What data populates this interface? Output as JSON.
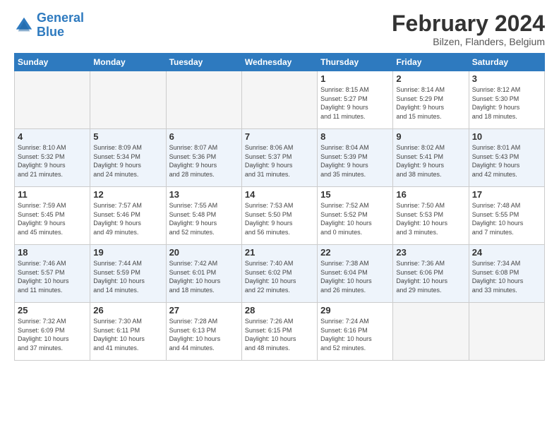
{
  "header": {
    "logo_line1": "General",
    "logo_line2": "Blue",
    "month_year": "February 2024",
    "location": "Bilzen, Flanders, Belgium"
  },
  "days_of_week": [
    "Sunday",
    "Monday",
    "Tuesday",
    "Wednesday",
    "Thursday",
    "Friday",
    "Saturday"
  ],
  "weeks": [
    [
      {
        "day": "",
        "info": ""
      },
      {
        "day": "",
        "info": ""
      },
      {
        "day": "",
        "info": ""
      },
      {
        "day": "",
        "info": ""
      },
      {
        "day": "1",
        "info": "Sunrise: 8:15 AM\nSunset: 5:27 PM\nDaylight: 9 hours\nand 11 minutes."
      },
      {
        "day": "2",
        "info": "Sunrise: 8:14 AM\nSunset: 5:29 PM\nDaylight: 9 hours\nand 15 minutes."
      },
      {
        "day": "3",
        "info": "Sunrise: 8:12 AM\nSunset: 5:30 PM\nDaylight: 9 hours\nand 18 minutes."
      }
    ],
    [
      {
        "day": "4",
        "info": "Sunrise: 8:10 AM\nSunset: 5:32 PM\nDaylight: 9 hours\nand 21 minutes."
      },
      {
        "day": "5",
        "info": "Sunrise: 8:09 AM\nSunset: 5:34 PM\nDaylight: 9 hours\nand 24 minutes."
      },
      {
        "day": "6",
        "info": "Sunrise: 8:07 AM\nSunset: 5:36 PM\nDaylight: 9 hours\nand 28 minutes."
      },
      {
        "day": "7",
        "info": "Sunrise: 8:06 AM\nSunset: 5:37 PM\nDaylight: 9 hours\nand 31 minutes."
      },
      {
        "day": "8",
        "info": "Sunrise: 8:04 AM\nSunset: 5:39 PM\nDaylight: 9 hours\nand 35 minutes."
      },
      {
        "day": "9",
        "info": "Sunrise: 8:02 AM\nSunset: 5:41 PM\nDaylight: 9 hours\nand 38 minutes."
      },
      {
        "day": "10",
        "info": "Sunrise: 8:01 AM\nSunset: 5:43 PM\nDaylight: 9 hours\nand 42 minutes."
      }
    ],
    [
      {
        "day": "11",
        "info": "Sunrise: 7:59 AM\nSunset: 5:45 PM\nDaylight: 9 hours\nand 45 minutes."
      },
      {
        "day": "12",
        "info": "Sunrise: 7:57 AM\nSunset: 5:46 PM\nDaylight: 9 hours\nand 49 minutes."
      },
      {
        "day": "13",
        "info": "Sunrise: 7:55 AM\nSunset: 5:48 PM\nDaylight: 9 hours\nand 52 minutes."
      },
      {
        "day": "14",
        "info": "Sunrise: 7:53 AM\nSunset: 5:50 PM\nDaylight: 9 hours\nand 56 minutes."
      },
      {
        "day": "15",
        "info": "Sunrise: 7:52 AM\nSunset: 5:52 PM\nDaylight: 10 hours\nand 0 minutes."
      },
      {
        "day": "16",
        "info": "Sunrise: 7:50 AM\nSunset: 5:53 PM\nDaylight: 10 hours\nand 3 minutes."
      },
      {
        "day": "17",
        "info": "Sunrise: 7:48 AM\nSunset: 5:55 PM\nDaylight: 10 hours\nand 7 minutes."
      }
    ],
    [
      {
        "day": "18",
        "info": "Sunrise: 7:46 AM\nSunset: 5:57 PM\nDaylight: 10 hours\nand 11 minutes."
      },
      {
        "day": "19",
        "info": "Sunrise: 7:44 AM\nSunset: 5:59 PM\nDaylight: 10 hours\nand 14 minutes."
      },
      {
        "day": "20",
        "info": "Sunrise: 7:42 AM\nSunset: 6:01 PM\nDaylight: 10 hours\nand 18 minutes."
      },
      {
        "day": "21",
        "info": "Sunrise: 7:40 AM\nSunset: 6:02 PM\nDaylight: 10 hours\nand 22 minutes."
      },
      {
        "day": "22",
        "info": "Sunrise: 7:38 AM\nSunset: 6:04 PM\nDaylight: 10 hours\nand 26 minutes."
      },
      {
        "day": "23",
        "info": "Sunrise: 7:36 AM\nSunset: 6:06 PM\nDaylight: 10 hours\nand 29 minutes."
      },
      {
        "day": "24",
        "info": "Sunrise: 7:34 AM\nSunset: 6:08 PM\nDaylight: 10 hours\nand 33 minutes."
      }
    ],
    [
      {
        "day": "25",
        "info": "Sunrise: 7:32 AM\nSunset: 6:09 PM\nDaylight: 10 hours\nand 37 minutes."
      },
      {
        "day": "26",
        "info": "Sunrise: 7:30 AM\nSunset: 6:11 PM\nDaylight: 10 hours\nand 41 minutes."
      },
      {
        "day": "27",
        "info": "Sunrise: 7:28 AM\nSunset: 6:13 PM\nDaylight: 10 hours\nand 44 minutes."
      },
      {
        "day": "28",
        "info": "Sunrise: 7:26 AM\nSunset: 6:15 PM\nDaylight: 10 hours\nand 48 minutes."
      },
      {
        "day": "29",
        "info": "Sunrise: 7:24 AM\nSunset: 6:16 PM\nDaylight: 10 hours\nand 52 minutes."
      },
      {
        "day": "",
        "info": ""
      },
      {
        "day": "",
        "info": ""
      }
    ]
  ]
}
